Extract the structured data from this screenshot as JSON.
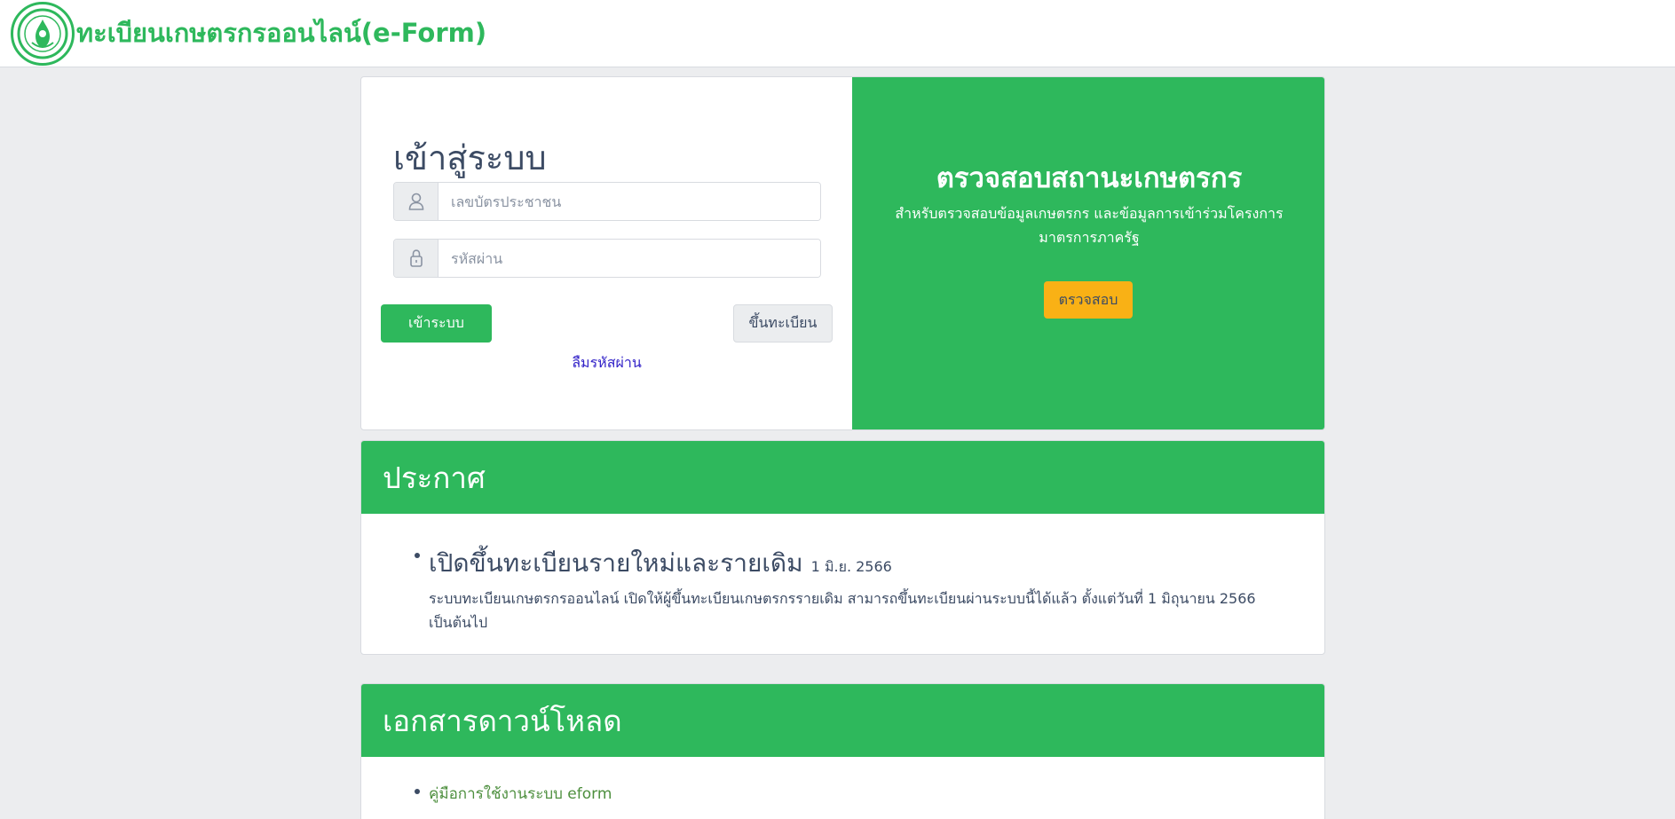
{
  "header": {
    "site_title": "ทะเบียนเกษตรกรออนไลน์(e-Form)",
    "logo_icon": "agriculture-department-seal"
  },
  "login": {
    "heading": "เข้าสู่ระบบ",
    "id_card": {
      "placeholder": "เลขบัตรประชาชน",
      "value": "",
      "icon": "user-icon"
    },
    "password": {
      "placeholder": "รหัสผ่าน",
      "value": "",
      "icon": "lock-icon"
    },
    "login_button": "เข้าระบบ",
    "register_button": "ขึ้นทะเบียน",
    "forgot_password": "ลืมรหัสผ่าน"
  },
  "status_check": {
    "title": "ตรวจสอบสถานะเกษตรกร",
    "description": "สำหรับตรวจสอบข้อมูลเกษตรกร และข้อมูลการเข้าร่วมโครงการมาตรการภาครัฐ",
    "button": "ตรวจสอบ"
  },
  "announcements": {
    "title": "ประกาศ",
    "items": [
      {
        "title": "เปิดขึ้นทะเบียนรายใหม่และรายเดิม",
        "date": "1 มิ.ย. 2566",
        "body": "ระบบทะเบียนเกษตรกรออนไลน์ เปิดให้ผู้ขึ้นทะเบียนเกษตรกรรายเดิม สามารถขึ้นทะเบียนผ่านระบบนี้ได้แล้ว ตั้งแต่วันที่ 1 มิถุนายน 2566 เป็นต้นไป"
      }
    ]
  },
  "downloads": {
    "title": "เอกสารดาวน์โหลด",
    "items": [
      {
        "label": "คู่มือการใช้งานระบบ eform"
      }
    ]
  },
  "colors": {
    "brand_green": "#2eb85c",
    "warning_yellow": "#f9b115",
    "link_blue": "#3222c8",
    "background": "#ecedef"
  }
}
